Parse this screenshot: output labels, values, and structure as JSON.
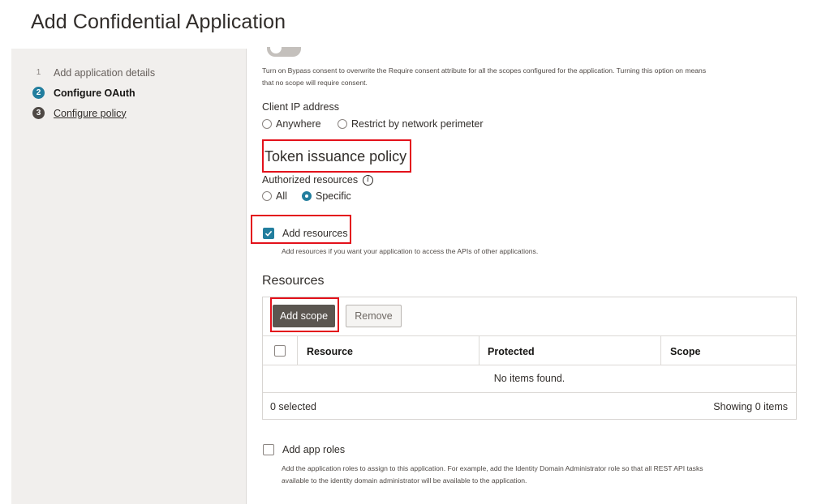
{
  "page": {
    "title": "Add Confidential Application"
  },
  "steps": [
    {
      "num": "1",
      "label": "Add application details"
    },
    {
      "num": "2",
      "label": "Configure OAuth"
    },
    {
      "num": "3",
      "label": "Configure policy"
    }
  ],
  "bypass": {
    "hint_line1": "Turn on Bypass consent to overwrite the Require consent attribute for all the scopes configured for the application. Turning this option on means",
    "hint_line2": "that no scope will require consent."
  },
  "client_ip": {
    "label": "Client IP address",
    "options": [
      "Anywhere",
      "Restrict by network perimeter"
    ]
  },
  "token_policy": {
    "title": "Token issuance policy",
    "authorized_label": "Authorized resources",
    "info_icon": "i",
    "options": [
      "All",
      "Specific"
    ],
    "selected": "Specific"
  },
  "add_resources": {
    "label": "Add resources",
    "checked": true,
    "hint": "Add resources if you want your application to access the APIs of other applications."
  },
  "resources": {
    "title": "Resources",
    "add_scope_label": "Add scope",
    "remove_label": "Remove",
    "columns": [
      "Resource",
      "Protected",
      "Scope"
    ],
    "empty_text": "No items found.",
    "selected_count": "0 selected",
    "showing_text": "Showing 0 items"
  },
  "app_roles": {
    "label": "Add app roles",
    "checked": false,
    "hint_line1": "Add the application roles to assign to this application. For example, add the Identity Domain Administrator role so that all REST API tasks",
    "hint_line2": "available to the identity domain administrator will be available to the application."
  },
  "colors": {
    "accent": "#227e9e",
    "highlight": "#e3111b",
    "sidebar_bg": "#f1efed",
    "primary_button": "#5b5650"
  }
}
